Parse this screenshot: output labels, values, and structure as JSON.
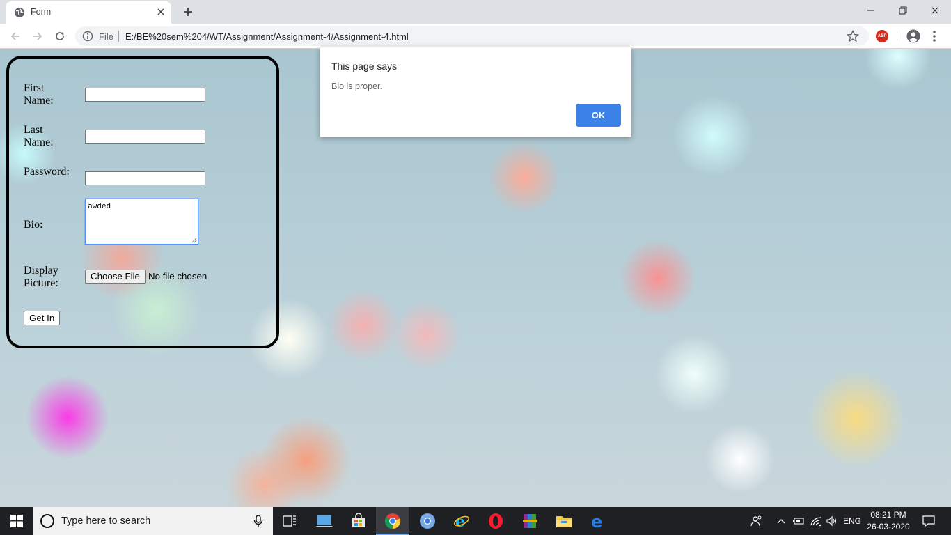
{
  "browser": {
    "tab_title": "Form",
    "address_scheme": "File",
    "address_url": "E:/BE%20sem%204/WT/Assignment/Assignment-4/Assignment-4.html",
    "extension_badge": "ABP"
  },
  "form": {
    "first_name_label": "First\nName:",
    "first_name_value": "",
    "last_name_label": "Last\nName:",
    "last_name_value": "",
    "password_label": "Password:",
    "password_value": "",
    "bio_label": "Bio:",
    "bio_value": "awded",
    "picture_label": "Display\nPicture:",
    "choose_file_label": "Choose File",
    "file_status": "No file chosen",
    "submit_label": "Get In"
  },
  "dialog": {
    "title": "This page says",
    "message": "Bio is proper.",
    "ok_label": "OK"
  },
  "taskbar": {
    "search_placeholder": "Type here to search",
    "language": "ENG",
    "time": "08:21 PM",
    "date": "26-03-2020"
  },
  "colors": {
    "dialog_ok": "#3b82e8",
    "taskbar": "#1f2023",
    "tab_bar": "#dee1e6"
  }
}
